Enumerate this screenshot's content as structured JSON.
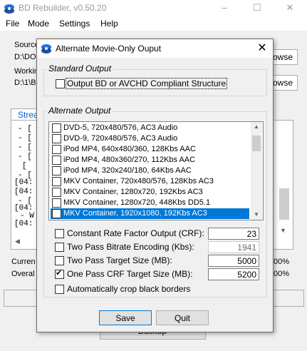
{
  "app": {
    "title": "BD Rebuilder, v0.50.20",
    "menu": [
      "File",
      "Mode",
      "Settings",
      "Help"
    ],
    "window_controls": {
      "minimize": "–",
      "maximize": "☐",
      "close": "✕"
    }
  },
  "background": {
    "source_label": "Source",
    "source_value": "D:\\DO",
    "working_label": "Workin",
    "working_value": "D:\\1\\B",
    "browse_label_1": "owse",
    "browse_label_2": "owse",
    "tab_label": "Strea",
    "log_lines": [
      "- [",
      "- [",
      "- [",
      "- [",
      "[",
      "- [",
      "[04:",
      "[04:",
      "- [",
      "[04:",
      "- W",
      "[04:"
    ],
    "current_label": "Curren",
    "overall_label": "Overal",
    "current_pct": "00%",
    "overall_pct": "00%",
    "backup_label": "Backup"
  },
  "dialog": {
    "title": "Alternate Movie-Only Ouput",
    "close": "✕",
    "standard_group_label": "Standard Output",
    "standard_checkbox_label": "Output BD or AVCHD Compliant Structure",
    "alternate_group_label": "Alternate Output",
    "list_items": [
      {
        "label": "DVD-5, 720x480/576, AC3 Audio",
        "checked": false,
        "selected": false
      },
      {
        "label": "DVD-9, 720x480/576, AC3 Audio",
        "checked": false,
        "selected": false
      },
      {
        "label": "iPod MP4, 640x480/360, 128Kbs AAC",
        "checked": false,
        "selected": false
      },
      {
        "label": "iPod MP4, 480x360/270, 112Kbs AAC",
        "checked": false,
        "selected": false
      },
      {
        "label": "iPod MP4, 320x240/180, 64Kbs AAC",
        "checked": false,
        "selected": false
      },
      {
        "label": "MKV Container, 720x480/576, 128Kbs AC3",
        "checked": false,
        "selected": false
      },
      {
        "label": "MKV Container, 1280x720, 192Kbs AC3",
        "checked": false,
        "selected": false
      },
      {
        "label": "MKV Container, 1280x720, 448Kbs DD5.1",
        "checked": false,
        "selected": false
      },
      {
        "label": "MKV Container, 1920x1080, 192Kbs AC3",
        "checked": true,
        "selected": true
      }
    ],
    "scroll_up": "▲",
    "scroll_down": "▼",
    "options": [
      {
        "label": "Constant Rate Factor Output (CRF):",
        "checked": false,
        "value": "23",
        "disabled": false
      },
      {
        "label": "Two Pass Bitrate Encoding (Kbs):",
        "checked": false,
        "value": "1941",
        "disabled": true
      },
      {
        "label": "Two Pass Target Size (MB):",
        "checked": false,
        "value": "5000",
        "disabled": false
      },
      {
        "label": "One Pass CRF Target Size (MB):",
        "checked": true,
        "value": "5200",
        "disabled": false
      }
    ],
    "autocrop_label": "Automatically crop black borders",
    "save_label": "Save",
    "quit_label": "Quit"
  },
  "colors": {
    "selection": "#0078d7",
    "icon_blue": "#1f5fbf"
  }
}
